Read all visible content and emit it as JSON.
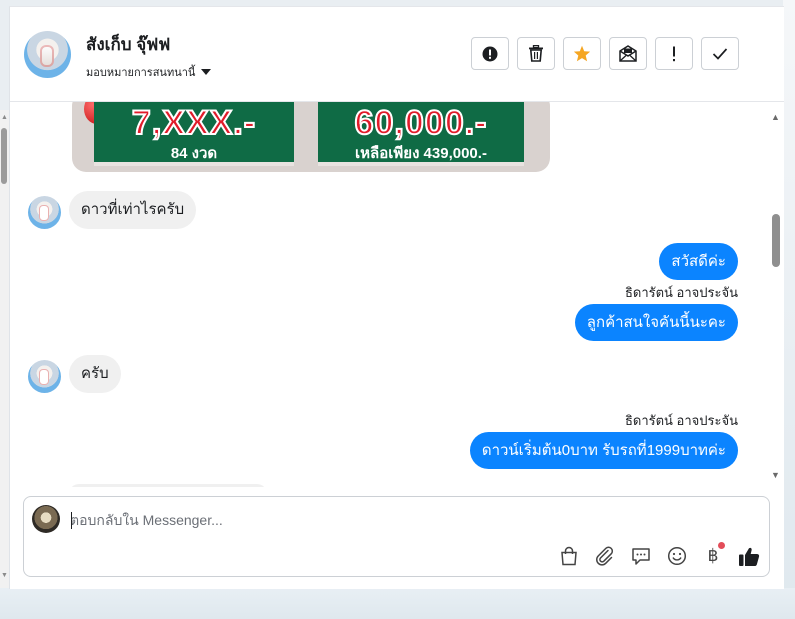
{
  "header": {
    "contact_name": "สังเก็บ จุ๊ฟฟ",
    "assign_label": "มอบหมายการสนทนานี้",
    "actions": [
      {
        "name": "report-button",
        "icon": "alert-circle-icon"
      },
      {
        "name": "delete-button",
        "icon": "trash-icon"
      },
      {
        "name": "star-button",
        "icon": "star-icon"
      },
      {
        "name": "mark-unread-button",
        "icon": "envelope-icon"
      },
      {
        "name": "spam-button",
        "icon": "exclamation-icon"
      },
      {
        "name": "done-button",
        "icon": "check-icon"
      }
    ]
  },
  "promo": {
    "left_price": "7,XXX.-",
    "left_sub": "84 งวด",
    "right_price": "60,000.-",
    "right_sub": "เหลือเพียง 439,000.-"
  },
  "messages": [
    {
      "direction": "in",
      "text": "ดาวที่เท่าไรครับ"
    },
    {
      "direction": "out",
      "text": "สวัสดีค่ะ"
    },
    {
      "direction": "out",
      "sender": "ธิดารัตน์ อาจประจัน",
      "text": "ลูกค้าสนใจคันนี้นะคะ"
    },
    {
      "direction": "in",
      "text": "ครับ"
    },
    {
      "direction": "out",
      "sender": "ธิดารัตน์ อาจประจัน",
      "text": "ดาวน์เริ่มต้น0บาท รับรถที่1999บาทค่ะ"
    }
  ],
  "composer": {
    "placeholder": "ตอบกลับใน Messenger...",
    "baht_symbol": "฿",
    "tools": [
      "bag-icon",
      "paperclip-icon",
      "speech-bubble-icon",
      "smiley-icon",
      "baht-icon",
      "thumbs-up-icon"
    ]
  },
  "colors": {
    "accent": "#0b84ff",
    "star": "#f5a623",
    "incoming_bubble": "#f0f0f0",
    "notification_dot": "#e34d59"
  }
}
